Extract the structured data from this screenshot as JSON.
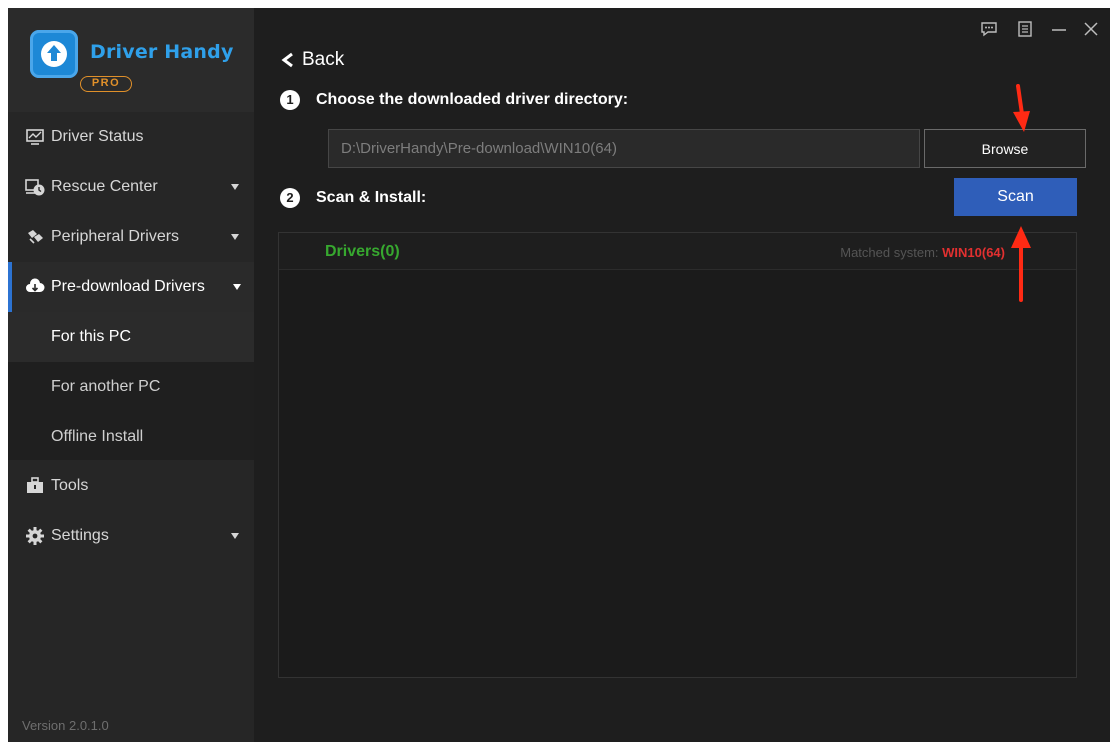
{
  "app": {
    "name": "Driver Handy",
    "edition": "PRO",
    "version": "Version 2.0.1.0"
  },
  "sidebar": {
    "items": [
      {
        "label": "Driver Status",
        "icon": "monitor-icon"
      },
      {
        "label": "Rescue Center",
        "icon": "rescue-clock-icon"
      },
      {
        "label": "Peripheral Drivers",
        "icon": "peripheral-plug-icon"
      },
      {
        "label": "Pre-download Drivers",
        "icon": "cloud-download-icon"
      },
      {
        "label": "Tools",
        "icon": "toolbox-icon"
      },
      {
        "label": "Settings",
        "icon": "gear-icon"
      }
    ],
    "subitems": [
      {
        "label": "For this PC",
        "selected": true
      },
      {
        "label": "For another PC"
      },
      {
        "label": "Offline Install"
      }
    ]
  },
  "header": {
    "icons": [
      "feedback-icon",
      "menu-list-icon",
      "minimize-icon",
      "close-icon"
    ]
  },
  "main": {
    "back_label": "Back",
    "step1": {
      "number": "1",
      "label": "Choose the downloaded driver directory:"
    },
    "path_value": "D:\\DriverHandy\\Pre-download\\WIN10(64)",
    "browse_label": "Browse",
    "step2": {
      "number": "2",
      "label": "Scan & Install:"
    },
    "scan_label": "Scan",
    "drivers_title": "Drivers(0)",
    "matched_label": "Matched system:",
    "matched_value": "WIN10(64)"
  },
  "colors": {
    "background": "#1e1e1e",
    "sidebar": "#262626",
    "accent_blue": "#2f5eb9",
    "brand_blue": "#2fa0ea",
    "pro_orange": "#e0902a",
    "drivers_green": "#37a82f",
    "highlight_red": "#e23030",
    "annotation_arrow": "#ff2a14"
  }
}
